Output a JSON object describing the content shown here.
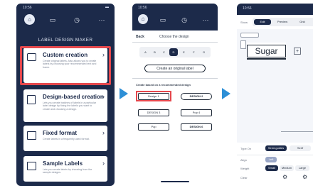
{
  "screen1": {
    "time": "10:56",
    "heading": "LABEL DESIGN MAKER",
    "cards": [
      {
        "title": "Custom creation",
        "desc": "Create original labels. Also allows you to create labels by choosing your recommended text and frame."
      },
      {
        "title": "Design-based creation",
        "desc": "Lets you create batches of labels in a particular label design by fixing the labels you want to create and choosing a design."
      },
      {
        "title": "Fixed format",
        "desc": "Create labels in a frequently used format."
      },
      {
        "title": "Sample Labels",
        "desc": "Lets you create labels by choosing from the sample designs."
      }
    ]
  },
  "screen2": {
    "time": "10:56",
    "back": "Back",
    "title": "Choose the design",
    "sizes": [
      "A",
      "B",
      "C",
      "D",
      "E",
      "F",
      "G"
    ],
    "create_button": "Create an original label",
    "section": "Create based on a recommended design",
    "designs": [
      "Design 1",
      "DESIGN 2",
      "DESIGN 3",
      "Pop 4",
      "Pop",
      "DESIGN 6"
    ]
  },
  "screen3": {
    "time": "10:56",
    "show_label": "Show",
    "show_tabs": [
      "Edit",
      "Preview",
      "Grid"
    ],
    "text_value": "Sugar",
    "type_on_label": "Type On",
    "type_on_options": [
      "Semi-guides",
      "Serif"
    ],
    "align_label": "Align",
    "align_options": [
      "Left"
    ],
    "weight_label": "Weight",
    "weight_options": [
      "Small",
      "Medium",
      "Large"
    ],
    "clear_label": "Clear"
  },
  "colors": {
    "navy": "#1c2a4a",
    "highlight": "#e5484d",
    "arrow": "#2d8fd6"
  }
}
